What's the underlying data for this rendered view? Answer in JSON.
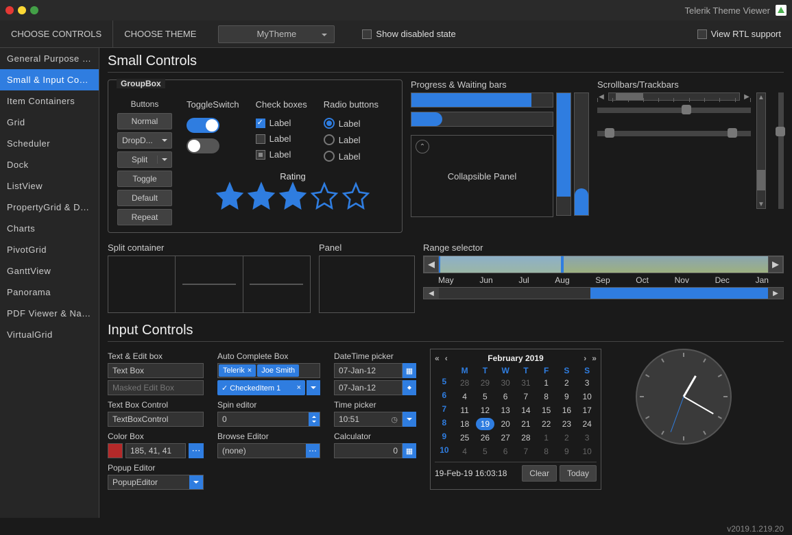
{
  "titlebar": {
    "title": "Telerik Theme Viewer"
  },
  "toolbar": {
    "choose_controls": "CHOOSE CONTROLS",
    "choose_theme": "CHOOSE THEME",
    "theme_value": "MyTheme",
    "show_disabled": "Show disabled state",
    "view_rtl": "View RTL support"
  },
  "sidebar": {
    "items": [
      "General Purpose C...",
      "Small & Input Contr...",
      "Item Containers",
      "Grid",
      "Scheduler",
      "Dock",
      "ListView",
      "PropertyGrid & Dat...",
      "Charts",
      "PivotGrid",
      "GanttView",
      "Panorama",
      "PDF Viewer & Navig...",
      "VirtualGrid"
    ],
    "selected": 1
  },
  "sections": {
    "small_controls": "Small Controls",
    "input_controls": "Input Controls"
  },
  "groupbox": {
    "legend": "GroupBox",
    "buttons_label": "Buttons",
    "buttons": [
      "Normal",
      "DropD...",
      "Split",
      "Toggle",
      "Default",
      "Repeat"
    ],
    "toggle_label": "ToggleSwitch",
    "checkboxes_label": "Check boxes",
    "checkbox_item": "Label",
    "radio_label": "Radio buttons",
    "radio_item": "Label",
    "rating_label": "Rating"
  },
  "progress": {
    "label": "Progress & Waiting bars",
    "collapsible": "Collapsible Panel"
  },
  "scrollbars": {
    "label": "Scrollbars/Trackbars"
  },
  "split_container": "Split container",
  "panel": "Panel",
  "range_selector": {
    "label": "Range selector",
    "months": [
      "May",
      "Jun",
      "Jul",
      "Aug",
      "Sep",
      "Oct",
      "Nov",
      "Dec",
      "Jan"
    ]
  },
  "inputs": {
    "text_edit": "Text & Edit box",
    "text_box": "Text Box",
    "masked": "Masked Edit Box",
    "tbc_label": "Text Box Control",
    "tbc_value": "TextBoxControl",
    "color_label": "Color Box",
    "color_value": "185, 41, 41",
    "popup_label": "Popup Editor",
    "popup_value": "PopupEditor",
    "auto_label": "Auto Complete Box",
    "tags": [
      "Telerik",
      "Joe Smith"
    ],
    "checked_item": "CheckedItem 1",
    "spin_label": "Spin editor",
    "spin_value": "0",
    "browse_label": "Browse Editor",
    "browse_value": "(none)",
    "dt_label": "DateTime picker",
    "dt_value": "07-Jan-12",
    "time_label": "Time picker",
    "time_value": "10:51",
    "calc_label": "Calculator",
    "calc_value": "0"
  },
  "calendar": {
    "month": "February 2019",
    "weekdays": [
      "M",
      "T",
      "W",
      "T",
      "F",
      "S",
      "S"
    ],
    "weeks": [
      {
        "num": "5",
        "days": [
          {
            "v": "28",
            "o": 1
          },
          {
            "v": "29",
            "o": 1
          },
          {
            "v": "30",
            "o": 1
          },
          {
            "v": "31",
            "o": 1
          },
          {
            "v": "1"
          },
          {
            "v": "2"
          },
          {
            "v": "3"
          }
        ]
      },
      {
        "num": "6",
        "days": [
          {
            "v": "4"
          },
          {
            "v": "5"
          },
          {
            "v": "6"
          },
          {
            "v": "7"
          },
          {
            "v": "8"
          },
          {
            "v": "9"
          },
          {
            "v": "10"
          }
        ]
      },
      {
        "num": "7",
        "days": [
          {
            "v": "11"
          },
          {
            "v": "12"
          },
          {
            "v": "13"
          },
          {
            "v": "14"
          },
          {
            "v": "15"
          },
          {
            "v": "16"
          },
          {
            "v": "17"
          }
        ]
      },
      {
        "num": "8",
        "days": [
          {
            "v": "18"
          },
          {
            "v": "19",
            "t": 1
          },
          {
            "v": "20"
          },
          {
            "v": "21"
          },
          {
            "v": "22"
          },
          {
            "v": "23"
          },
          {
            "v": "24"
          }
        ]
      },
      {
        "num": "9",
        "days": [
          {
            "v": "25"
          },
          {
            "v": "26"
          },
          {
            "v": "27"
          },
          {
            "v": "28"
          },
          {
            "v": "1",
            "o": 1
          },
          {
            "v": "2",
            "o": 1
          },
          {
            "v": "3",
            "o": 1
          }
        ]
      },
      {
        "num": "10",
        "days": [
          {
            "v": "4",
            "o": 1
          },
          {
            "v": "5",
            "o": 1
          },
          {
            "v": "6",
            "o": 1
          },
          {
            "v": "7",
            "o": 1
          },
          {
            "v": "8",
            "o": 1
          },
          {
            "v": "9",
            "o": 1
          },
          {
            "v": "10",
            "o": 1
          }
        ]
      }
    ],
    "footer_date": "19-Feb-19 16:03:18",
    "clear": "Clear",
    "today": "Today"
  },
  "footer": {
    "version": "v2019.1.219.20"
  }
}
